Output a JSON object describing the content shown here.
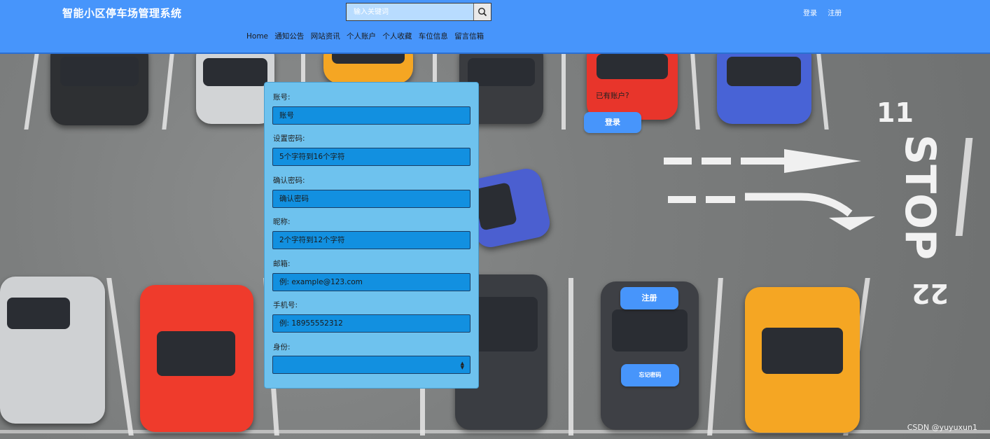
{
  "header": {
    "site_title": "智能小区停车场管理系统",
    "search": {
      "placeholder": "输入关键词",
      "icon": "search-icon"
    },
    "top_links": [
      "登录",
      "注册"
    ],
    "nav": [
      "Home",
      "通知公告",
      "网站资讯",
      "个人账户",
      "个人收藏",
      "车位信息",
      "留言信箱"
    ]
  },
  "form": {
    "fields": [
      {
        "label": "账号:",
        "placeholder": "账号"
      },
      {
        "label": "设置密码:",
        "placeholder": "5个字符到16个字符"
      },
      {
        "label": "确认密码:",
        "placeholder": "确认密码"
      },
      {
        "label": "昵称:",
        "placeholder": "2个字符到12个字符"
      },
      {
        "label": "邮箱:",
        "placeholder": "例: example@123.com"
      },
      {
        "label": "手机号:",
        "placeholder": "例: 18955552312"
      },
      {
        "label": "身份:",
        "selected": ""
      }
    ]
  },
  "side": {
    "already_text": "已有账户?",
    "login_button": "登录",
    "register_button": "注册",
    "forgot_button": "忘记密码"
  },
  "background": {
    "road_numbers": [
      "11",
      "22"
    ],
    "stop_text": "STOP"
  },
  "watermark": "CSDN @yuyuxun1"
}
